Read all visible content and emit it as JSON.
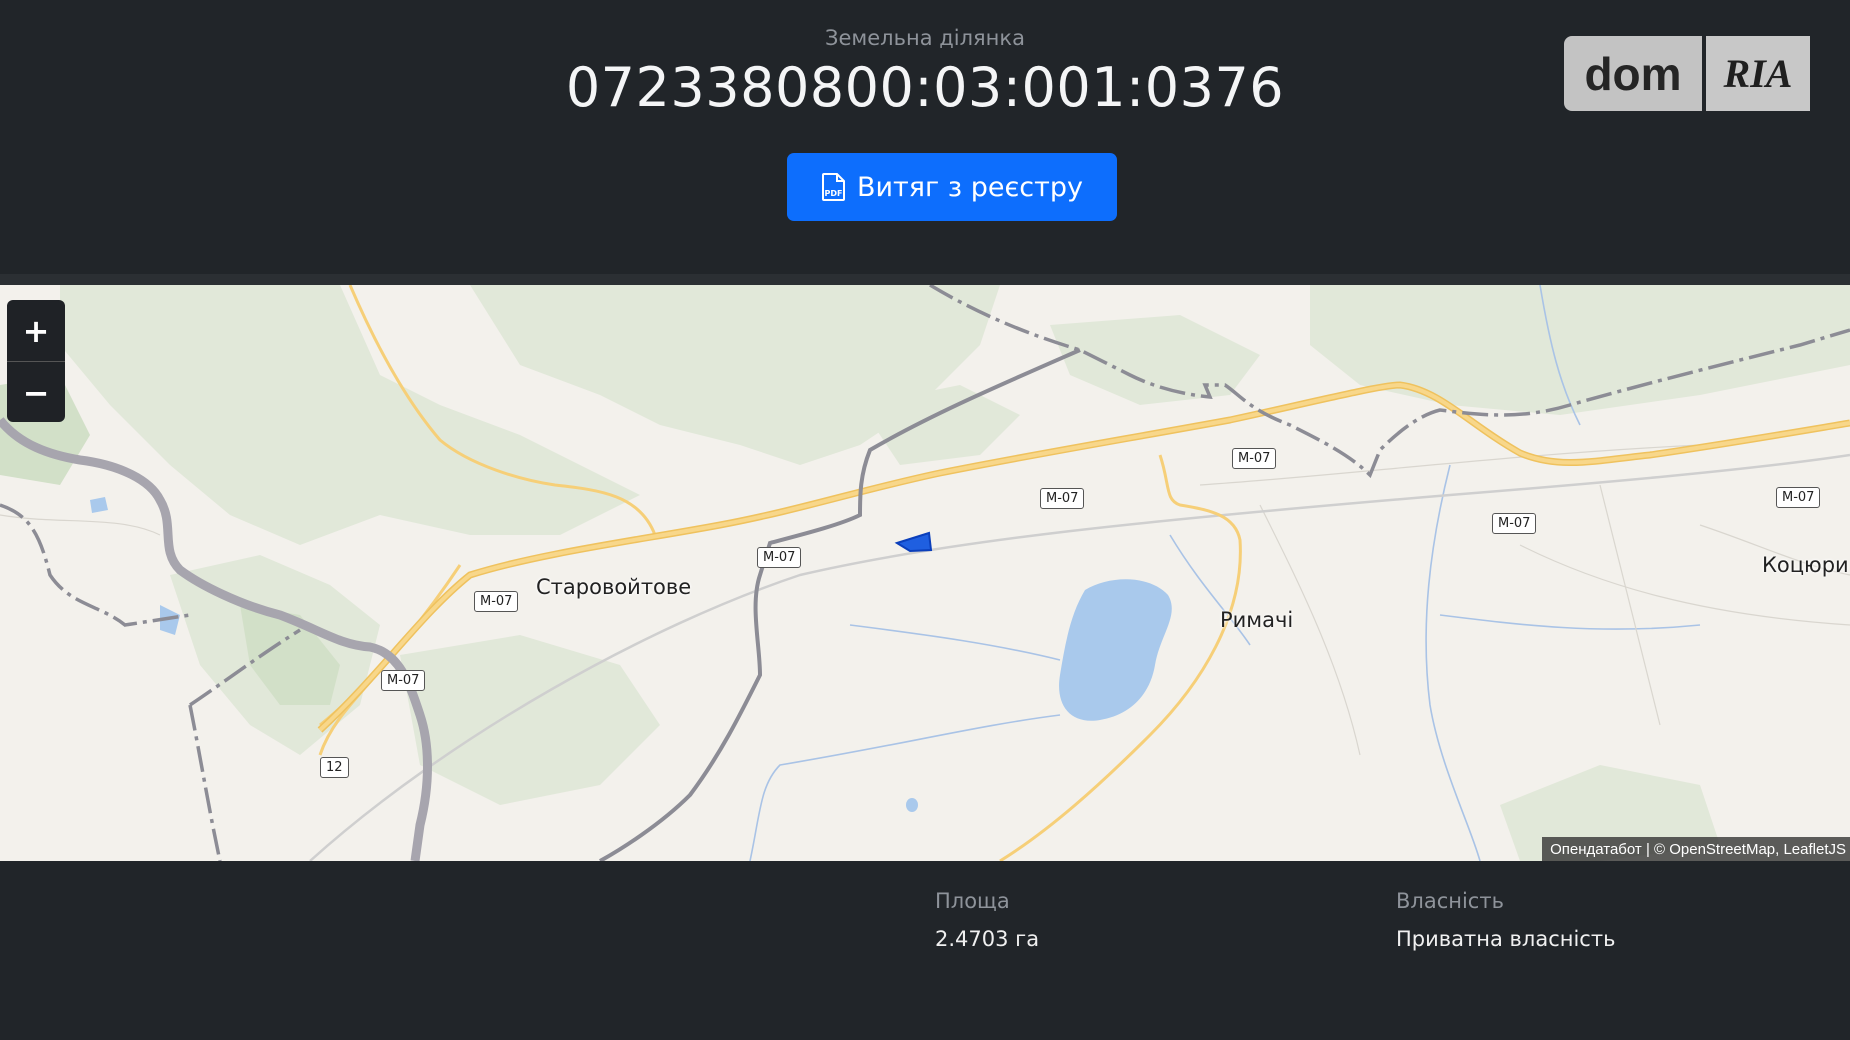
{
  "header": {
    "subtitle": "Земельна ділянка",
    "cadastral_number": "0723380800:03:001:0376",
    "extract_button_label": "Витяг з реєстру",
    "extract_button_icon": "pdf-file-icon"
  },
  "logo": {
    "left_text": "dom",
    "right_text": "RIA"
  },
  "map": {
    "zoom_in_label": "+",
    "zoom_out_label": "−",
    "places": {
      "starovoitove": "Старовойтове",
      "rymachi": "Римачі",
      "kotsiury": "Коцюри"
    },
    "road_shields": {
      "m07": "M-07",
      "r12": "12"
    },
    "attribution": "Опендатабот | © OpenStreetMap, LeafletJS",
    "colors": {
      "road": "#f6cf78",
      "border": "#888890",
      "water": "#9fc4ea",
      "parcel": "#1f5fe0"
    }
  },
  "details": {
    "area_label": "Площа",
    "area_value": "2.4703 га",
    "ownership_label": "Власність",
    "ownership_value": "Приватна власність"
  }
}
